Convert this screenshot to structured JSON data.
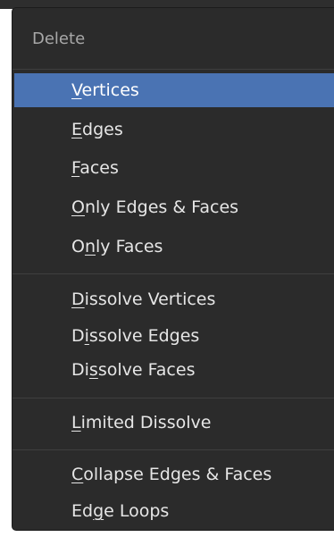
{
  "menu": {
    "title": "Delete",
    "items": [
      {
        "pre": "",
        "key": "V",
        "post": "ertices",
        "active": true
      },
      {
        "pre": "",
        "key": "E",
        "post": "dges",
        "active": false
      },
      {
        "pre": "",
        "key": "F",
        "post": "aces",
        "active": false
      },
      {
        "pre": "",
        "key": "O",
        "post": "nly Edges & Faces",
        "active": false
      },
      {
        "pre": "O",
        "key": "n",
        "post": "ly Faces",
        "active": false
      },
      {
        "pre": "",
        "key": "D",
        "post": "issolve Vertices",
        "active": false
      },
      {
        "pre": "D",
        "key": "i",
        "post": "ssolve Edges",
        "active": false
      },
      {
        "pre": "Di",
        "key": "s",
        "post": "solve Faces",
        "active": false
      },
      {
        "pre": "",
        "key": "L",
        "post": "imited Dissolve",
        "active": false
      },
      {
        "pre": "",
        "key": "C",
        "post": "ollapse Edges & Faces",
        "active": false
      },
      {
        "pre": "Ed",
        "key": "g",
        "post": "e Loops",
        "active": false
      }
    ]
  },
  "colors": {
    "menu_bg": "#2b2b2b",
    "highlight": "#4a73b3",
    "text": "#e6e6e6",
    "title_text": "#a8a8a8",
    "separator": "#3f3f3f"
  }
}
